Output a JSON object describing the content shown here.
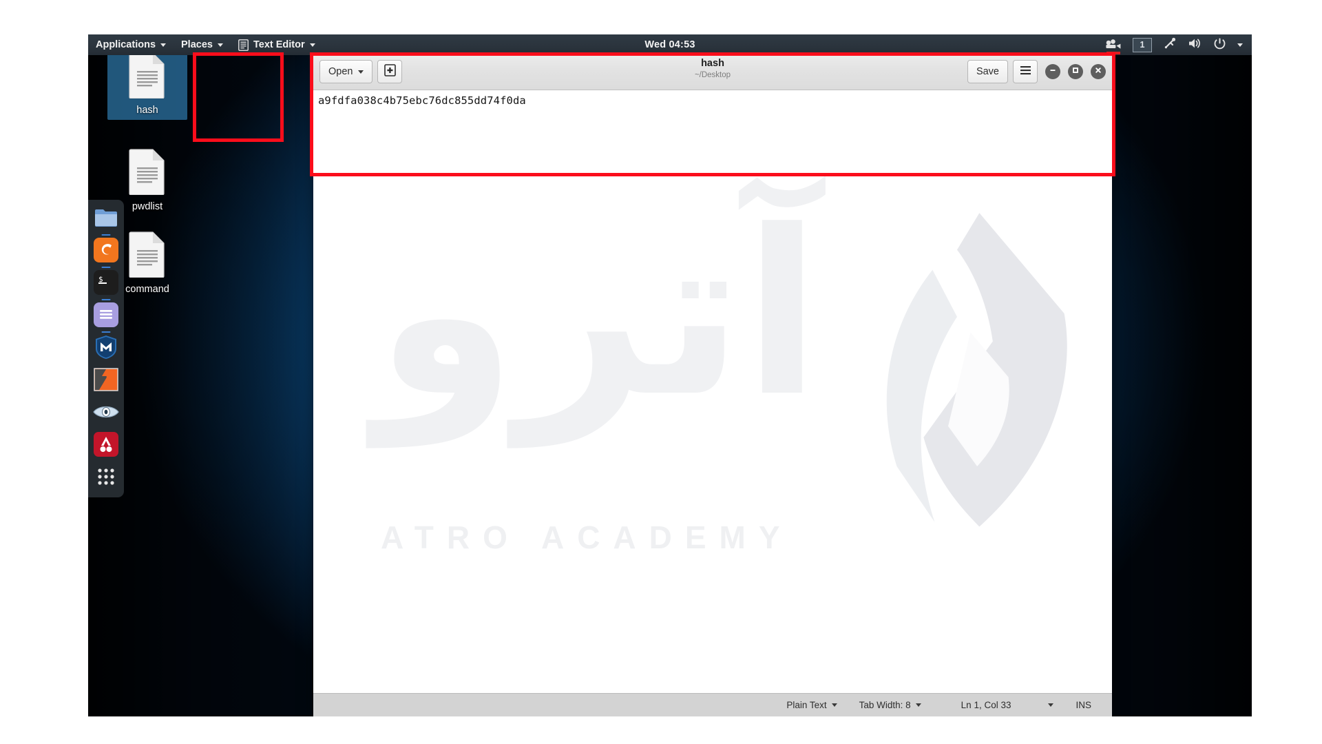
{
  "topbar": {
    "applications": "Applications",
    "places": "Places",
    "app_menu": "Text Editor",
    "app_menu_icon": "text-editor-icon",
    "clock": "Wed 04:53",
    "tray": {
      "recorder_icon": "screen-recorder-icon",
      "workspace": "1",
      "bluetooth_icon": "bluetooth-icon",
      "volume_icon": "volume-icon",
      "power_icon": "power-icon",
      "menu_caret": "chevron-down-icon"
    }
  },
  "dock": {
    "items": [
      {
        "name": "files",
        "icon": "folder-icon",
        "running": true
      },
      {
        "name": "firefox",
        "icon": "firefox-icon",
        "running": true
      },
      {
        "name": "terminal",
        "icon": "terminal-icon",
        "running": true
      },
      {
        "name": "text-editor",
        "icon": "text-editor-icon",
        "running": true
      },
      {
        "name": "metasploit",
        "icon": "metasploit-shield-icon",
        "running": false
      },
      {
        "name": "burpsuite",
        "icon": "burpsuite-icon",
        "running": false
      },
      {
        "name": "wireshark",
        "icon": "wireshark-eye-icon",
        "running": false
      },
      {
        "name": "beef",
        "icon": "beef-icon",
        "running": false
      },
      {
        "name": "show-applications",
        "icon": "app-grid-icon",
        "running": false
      }
    ]
  },
  "desktop": {
    "icons": [
      {
        "label": "hash",
        "icon": "text-file-icon",
        "selected": true
      },
      {
        "label": "pwdlist",
        "icon": "text-file-icon",
        "selected": false
      },
      {
        "label": "command",
        "icon": "text-file-icon",
        "selected": false
      }
    ]
  },
  "window": {
    "open_label": "Open",
    "open_caret_icon": "chevron-down-icon",
    "new_tab_icon": "new-document-icon",
    "title": "hash",
    "subtitle": "~/Desktop",
    "save_label": "Save",
    "menu_icon": "hamburger-menu-icon",
    "minimize_icon": "minimize-icon",
    "maximize_icon": "maximize-icon",
    "close_icon": "close-icon",
    "document_text": "a9fdfa038c4b75ebc76dc855dd74f0da",
    "statusbar": {
      "language": "Plain Text",
      "language_caret_icon": "chevron-down-icon",
      "tab_width": "Tab Width: 8",
      "tab_width_caret_icon": "chevron-down-icon",
      "cursor_position": "Ln 1, Col 33",
      "position_caret_icon": "chevron-down-icon",
      "insert_mode": "INS"
    }
  },
  "watermark": {
    "arabic": "آترو",
    "latin": "ATRO ACADEMY",
    "logo_icon": "atro-logo-icon"
  },
  "annotations": {
    "window_highlight_color": "#fb0d1b",
    "icon_highlight_color": "#fb0d1b"
  }
}
